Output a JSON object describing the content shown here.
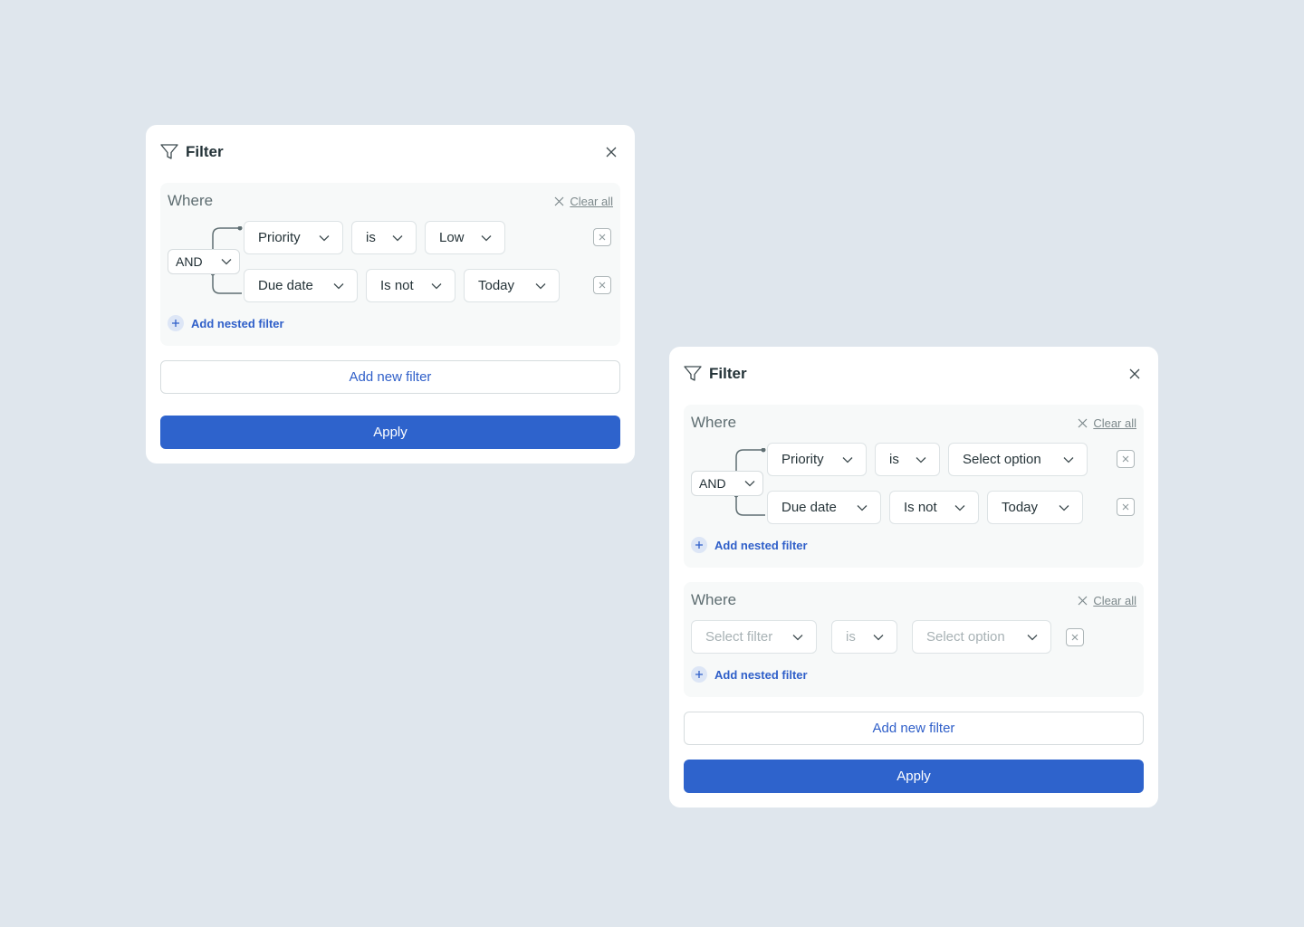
{
  "panel1": {
    "title": "Filter",
    "where_label": "Where",
    "clear_all": "Clear all",
    "logic": "AND",
    "row1": {
      "field": "Priority",
      "operator": "is",
      "value": "Low"
    },
    "row2": {
      "field": "Due date",
      "operator": "Is not",
      "value": "Today"
    },
    "add_nested": "Add nested filter",
    "add_new_filter": "Add new filter",
    "apply": "Apply"
  },
  "panel2": {
    "title": "Filter",
    "where1": {
      "label": "Where",
      "clear_all": "Clear all",
      "logic": "AND",
      "row1": {
        "field": "Priority",
        "operator": "is",
        "value": "Select option"
      },
      "row2": {
        "field": "Due date",
        "operator": "Is not",
        "value": "Today"
      },
      "add_nested": "Add nested filter"
    },
    "where2": {
      "label": "Where",
      "clear_all": "Clear all",
      "row1": {
        "field": "Select filter",
        "operator": "is",
        "value": "Select option"
      },
      "add_nested": "Add nested filter"
    },
    "add_new_filter": "Add new filter",
    "apply": "Apply"
  },
  "colors": {
    "background": "#dfe6ed",
    "accent": "#2e63cc",
    "link": "#2f5fc9"
  }
}
